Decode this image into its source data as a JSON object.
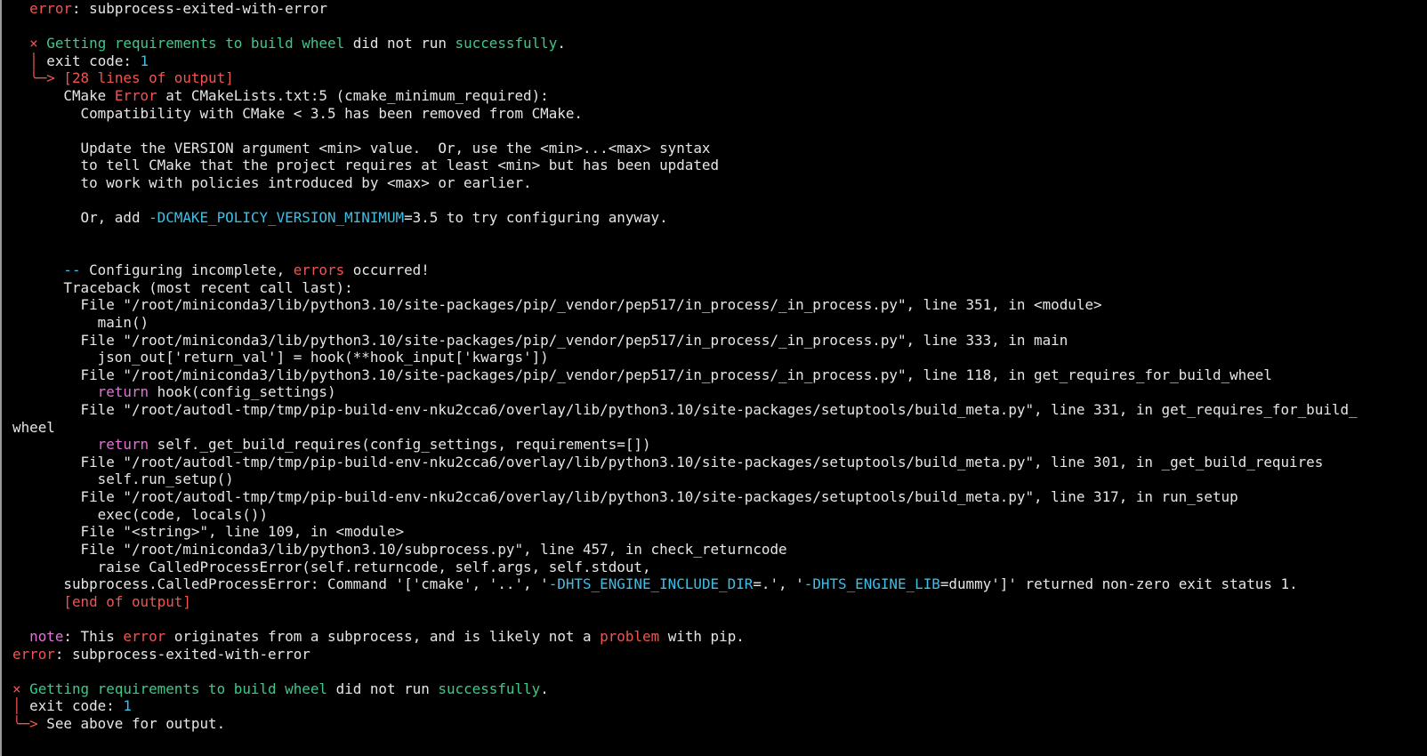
{
  "lines": [
    [
      {
        "t": "  ",
        "c": "default"
      },
      {
        "t": "error",
        "c": "red"
      },
      {
        "t": ": subprocess-exited-with-error",
        "c": "default"
      }
    ],
    [
      {
        "t": "",
        "c": "default"
      }
    ],
    [
      {
        "t": "  ",
        "c": "default"
      },
      {
        "t": "×",
        "c": "red"
      },
      {
        "t": " Getting requirements to build wheel",
        "c": "green"
      },
      {
        "t": " did not run ",
        "c": "default"
      },
      {
        "t": "successfully",
        "c": "green"
      },
      {
        "t": ".",
        "c": "default"
      }
    ],
    [
      {
        "t": "  ",
        "c": "default"
      },
      {
        "t": "│",
        "c": "red"
      },
      {
        "t": " exit code: ",
        "c": "default"
      },
      {
        "t": "1",
        "c": "cyan"
      }
    ],
    [
      {
        "t": "  ",
        "c": "default"
      },
      {
        "t": "╰─>",
        "c": "red"
      },
      {
        "t": " [28 lines of output]",
        "c": "red"
      }
    ],
    [
      {
        "t": "      CMake ",
        "c": "default"
      },
      {
        "t": "Error",
        "c": "red"
      },
      {
        "t": " at CMakeLists.txt:5 (cmake_minimum_required):",
        "c": "default"
      }
    ],
    [
      {
        "t": "        Compatibility with CMake < 3.5 has been removed from CMake.",
        "c": "default"
      }
    ],
    [
      {
        "t": "",
        "c": "default"
      }
    ],
    [
      {
        "t": "        Update the VERSION argument <min> value.  Or, use the <min>...<max> syntax",
        "c": "default"
      }
    ],
    [
      {
        "t": "        to tell CMake that the project requires at least <min> but has been updated",
        "c": "default"
      }
    ],
    [
      {
        "t": "        to work with policies introduced by <max> or earlier.",
        "c": "default"
      }
    ],
    [
      {
        "t": "",
        "c": "default"
      }
    ],
    [
      {
        "t": "        Or, add ",
        "c": "default"
      },
      {
        "t": "-DCMAKE_POLICY_VERSION_MINIMUM",
        "c": "cyan"
      },
      {
        "t": "=3.5 to try configuring anyway.",
        "c": "default"
      }
    ],
    [
      {
        "t": "",
        "c": "default"
      }
    ],
    [
      {
        "t": "",
        "c": "default"
      }
    ],
    [
      {
        "t": "      ",
        "c": "default"
      },
      {
        "t": "--",
        "c": "cyan"
      },
      {
        "t": " Configuring incomplete, ",
        "c": "default"
      },
      {
        "t": "errors",
        "c": "red"
      },
      {
        "t": " occurred!",
        "c": "default"
      }
    ],
    [
      {
        "t": "      Traceback (most recent call last):",
        "c": "default"
      }
    ],
    [
      {
        "t": "        File \"/root/miniconda3/lib/python3.10/site-packages/pip/_vendor/pep517/in_process/_in_process.py\", line 351, in <module>",
        "c": "default"
      }
    ],
    [
      {
        "t": "          main()",
        "c": "default"
      }
    ],
    [
      {
        "t": "        File \"/root/miniconda3/lib/python3.10/site-packages/pip/_vendor/pep517/in_process/_in_process.py\", line 333, in main",
        "c": "default"
      }
    ],
    [
      {
        "t": "          json_out['return_val'] = hook(**hook_input['kwargs'])",
        "c": "default"
      }
    ],
    [
      {
        "t": "        File \"/root/miniconda3/lib/python3.10/site-packages/pip/_vendor/pep517/in_process/_in_process.py\", line 118, in get_requires_for_build_wheel",
        "c": "default"
      }
    ],
    [
      {
        "t": "          ",
        "c": "default"
      },
      {
        "t": "return",
        "c": "magenta"
      },
      {
        "t": " hook(config_settings)",
        "c": "default"
      }
    ],
    [
      {
        "t": "        File \"/root/autodl-tmp/tmp/pip-build-env-nku2cca6/overlay/lib/python3.10/site-packages/setuptools/build_meta.py\", line 331, in get_requires_for_build_",
        "c": "default"
      }
    ],
    [
      {
        "t": "wheel",
        "c": "default"
      }
    ],
    [
      {
        "t": "          ",
        "c": "default"
      },
      {
        "t": "return",
        "c": "magenta"
      },
      {
        "t": " self._get_build_requires(config_settings, requirements=[])",
        "c": "default"
      }
    ],
    [
      {
        "t": "        File \"/root/autodl-tmp/tmp/pip-build-env-nku2cca6/overlay/lib/python3.10/site-packages/setuptools/build_meta.py\", line 301, in _get_build_requires",
        "c": "default"
      }
    ],
    [
      {
        "t": "          self.run_setup()",
        "c": "default"
      }
    ],
    [
      {
        "t": "        File \"/root/autodl-tmp/tmp/pip-build-env-nku2cca6/overlay/lib/python3.10/site-packages/setuptools/build_meta.py\", line 317, in run_setup",
        "c": "default"
      }
    ],
    [
      {
        "t": "          exec(code, locals())",
        "c": "default"
      }
    ],
    [
      {
        "t": "        File \"<string>\", line 109, in <module>",
        "c": "default"
      }
    ],
    [
      {
        "t": "        File \"/root/miniconda3/lib/python3.10/subprocess.py\", line 457, in check_returncode",
        "c": "default"
      }
    ],
    [
      {
        "t": "          raise CalledProcessError(self.returncode, self.args, self.stdout,",
        "c": "default"
      }
    ],
    [
      {
        "t": "      subprocess.CalledProcessError: Command '['cmake', '..', '",
        "c": "default"
      },
      {
        "t": "-DHTS_ENGINE_INCLUDE_DIR",
        "c": "cyan"
      },
      {
        "t": "=.', '",
        "c": "default"
      },
      {
        "t": "-DHTS_ENGINE_LIB",
        "c": "cyan"
      },
      {
        "t": "=dummy']' returned non-zero exit status 1.",
        "c": "default"
      }
    ],
    [
      {
        "t": "      ",
        "c": "default"
      },
      {
        "t": "[end of output]",
        "c": "red"
      }
    ],
    [
      {
        "t": "",
        "c": "default"
      }
    ],
    [
      {
        "t": "  ",
        "c": "default"
      },
      {
        "t": "note",
        "c": "magenta"
      },
      {
        "t": ": This ",
        "c": "default"
      },
      {
        "t": "error",
        "c": "red"
      },
      {
        "t": " originates from a subprocess, and is likely not a ",
        "c": "default"
      },
      {
        "t": "problem",
        "c": "red"
      },
      {
        "t": " with pip.",
        "c": "default"
      }
    ],
    [
      {
        "t": "error",
        "c": "red"
      },
      {
        "t": ": subprocess-exited-with-error",
        "c": "default"
      }
    ],
    [
      {
        "t": "",
        "c": "default"
      }
    ],
    [
      {
        "t": "×",
        "c": "red"
      },
      {
        "t": " Getting requirements to build wheel",
        "c": "green"
      },
      {
        "t": " did not run ",
        "c": "default"
      },
      {
        "t": "successfully",
        "c": "green"
      },
      {
        "t": ".",
        "c": "default"
      }
    ],
    [
      {
        "t": "│",
        "c": "red"
      },
      {
        "t": " exit code: ",
        "c": "default"
      },
      {
        "t": "1",
        "c": "cyan"
      }
    ],
    [
      {
        "t": "╰─>",
        "c": "red"
      },
      {
        "t": " See above for output.",
        "c": "default"
      }
    ]
  ]
}
